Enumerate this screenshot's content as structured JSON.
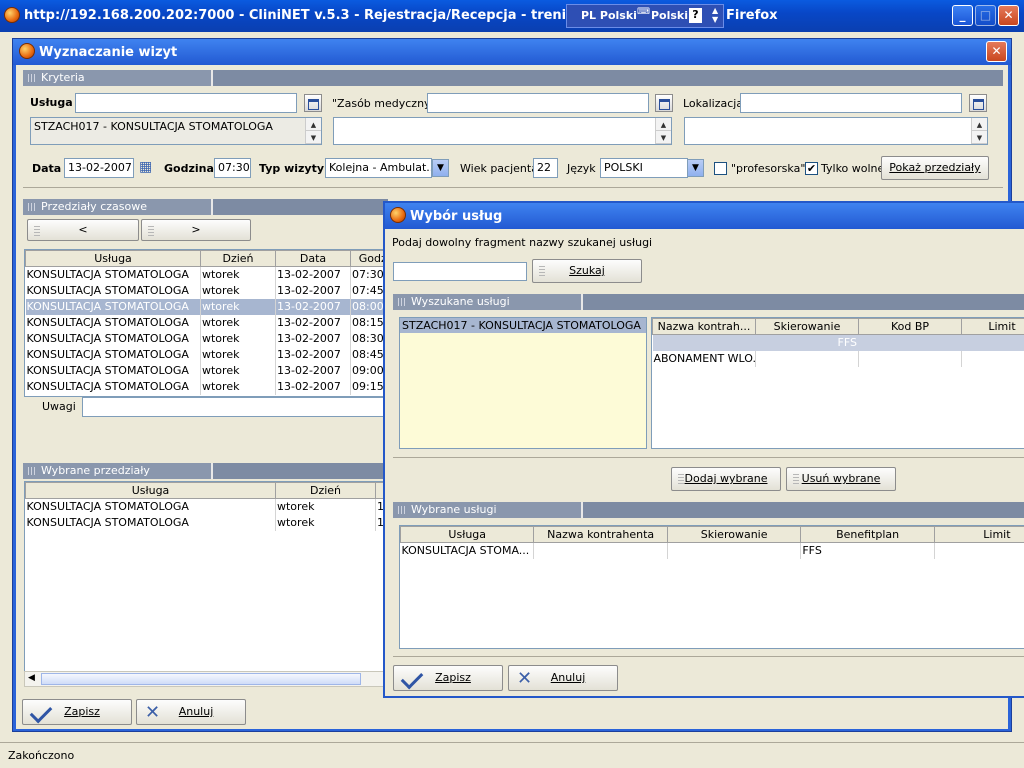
{
  "browser": {
    "title": "http://192.168.200.202:7000 - CliniNET v.5.3 - Rejestracja/Recepcja - trening (trenin",
    "title_tail": "Firefox",
    "lang1": "PL Polski",
    "lang2": "Polski",
    "help": "?",
    "status": "Zakończono"
  },
  "window": {
    "title": "Wyznaczanie wizyt"
  },
  "criteria": {
    "header": "Kryteria",
    "service_label": "Usługa",
    "service_value": "",
    "service_list": "STZACH017 - KONSULTACJA STOMATOLOGA",
    "resource_label": "\"Zasób medyczny\"",
    "resource_value": "",
    "location_label": "Lokalizacja",
    "location_value": "",
    "date_label": "Data",
    "date_value": "13-02-2007",
    "time_label": "Godzina",
    "time_value": "07:30",
    "visit_type_label": "Typ wizyty",
    "visit_type_value": "Kolejna - Ambulat...",
    "age_label": "Wiek pacjenta",
    "age_value": "22",
    "language_label": "Język",
    "language_value": "POLSKI",
    "professor_label": "\"profesorska\"",
    "only_free_label": "Tylko wolne",
    "only_free_checked": "✔",
    "show_button": "Pokaż przedziały"
  },
  "slots": {
    "header": "Przedziały czasowe",
    "prev": "<",
    "next": ">",
    "columns": [
      "Usługa",
      "Dzień",
      "Data",
      "Godz..."
    ],
    "rows": [
      [
        "KONSULTACJA STOMATOLOGA",
        "wtorek",
        "13-02-2007",
        "07:30"
      ],
      [
        "KONSULTACJA STOMATOLOGA",
        "wtorek",
        "13-02-2007",
        "07:45"
      ],
      [
        "KONSULTACJA STOMATOLOGA",
        "wtorek",
        "13-02-2007",
        "08:00"
      ],
      [
        "KONSULTACJA STOMATOLOGA",
        "wtorek",
        "13-02-2007",
        "08:15"
      ],
      [
        "KONSULTACJA STOMATOLOGA",
        "wtorek",
        "13-02-2007",
        "08:30"
      ],
      [
        "KONSULTACJA STOMATOLOGA",
        "wtorek",
        "13-02-2007",
        "08:45"
      ],
      [
        "KONSULTACJA STOMATOLOGA",
        "wtorek",
        "13-02-2007",
        "09:00"
      ],
      [
        "KONSULTACJA STOMATOLOGA",
        "wtorek",
        "13-02-2007",
        "09:15"
      ]
    ],
    "notes_label": "Uwagi"
  },
  "chosen": {
    "header": "Wybrane przedziały",
    "columns": [
      "Usługa",
      "Dzień",
      "13"
    ],
    "rows": [
      [
        "KONSULTACJA STOMATOLOGA",
        "wtorek",
        "13"
      ],
      [
        "KONSULTACJA STOMATOLOGA",
        "wtorek",
        "13"
      ]
    ]
  },
  "main_buttons": {
    "save": "Zapisz",
    "cancel": "Anuluj"
  },
  "dialog": {
    "title": "Wybór usług",
    "hint": "Podaj dowolny fragment nazwy szukanej usługi",
    "search_value": "",
    "search_button": "Szukaj",
    "found_header": "Wyszukane usługi",
    "found_item": "STZACH017 - KONSULTACJA STOMATOLOGA",
    "found_columns": [
      "Nazwa kontrah...",
      "Skierowanie",
      "Kod BP",
      "Limit"
    ],
    "found_group": "FFS",
    "found_rows": [
      [
        "ABONAMENT WLO...",
        "",
        "",
        ""
      ]
    ],
    "add_button": "Dodaj wybrane",
    "remove_button": "Usuń wybrane",
    "selected_header": "Wybrane usługi",
    "selected_columns": [
      "Usługa",
      "Nazwa kontrahenta",
      "Skierowanie",
      "Benefitplan",
      "Limit"
    ],
    "selected_rows": [
      [
        "KONSULTACJA STOMA...",
        "",
        "",
        "FFS",
        ""
      ]
    ],
    "save": "Zapisz",
    "cancel": "Anuluj"
  }
}
